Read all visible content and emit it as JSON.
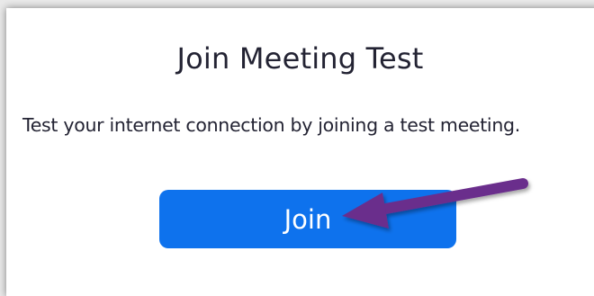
{
  "page": {
    "title": "Join Meeting Test",
    "description": "Test your internet connection by joining a test meeting.",
    "join_label": "Join"
  },
  "colors": {
    "button": "#0e72ed",
    "arrow": "#6b2d8c",
    "text": "#232333"
  },
  "icons": {
    "annotation": "arrow-icon"
  }
}
